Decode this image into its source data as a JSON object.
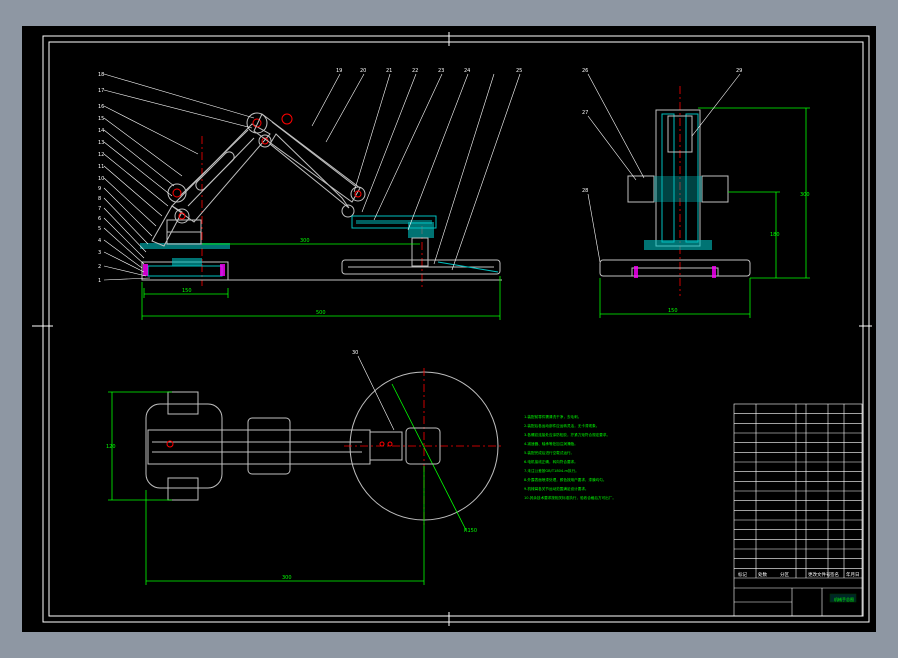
{
  "colors": {
    "background": "#8e97a3",
    "paper": "#000000",
    "frame": "#ffffff",
    "dimension": "#00ff00",
    "part": "#c0c0c0",
    "section": "#00c0c0",
    "centerline": "#ff0000",
    "bolt": "#ff00ff",
    "title_block": "#ffffff"
  },
  "drawing": {
    "front_view": {
      "leaders_left": [
        "1",
        "2",
        "3",
        "4",
        "5",
        "6",
        "7",
        "8",
        "9",
        "10",
        "11",
        "12",
        "13",
        "14",
        "15",
        "16",
        "17",
        "18"
      ],
      "leaders_top": [
        "19",
        "20",
        "21",
        "22",
        "23",
        "24",
        "25"
      ],
      "dim_base": "150",
      "dim_total": "500",
      "dim_height": "300"
    },
    "side_view": {
      "leaders": [
        "26",
        "27",
        "28",
        "29"
      ],
      "dim_width": "150",
      "dim_height_1": "180",
      "dim_height_2": "300"
    },
    "top_view": {
      "leader": "30",
      "dim_height": "120",
      "dim_length": "300",
      "dim_radius": "R150"
    },
    "technical_requirements": [
      "1.装配前零件需清洗干净，去毛刺。",
      "2.装配后各运动部件应运转灵活，无卡滞现象。",
      "3.各螺纹连接处应涂防松胶，拧紧力矩符合规定要求。",
      "4.减速器、轴承等处加注润滑脂。",
      "5.装配完成后进行空载试运行。",
      "6.电机接线正确，转向符合要求。",
      "7.未注公差按GB/T1804-m执行。",
      "8.外露表面喷漆处理，颜色按用户要求，漆膜均匀。",
      "9.机械臂各关节运动范围满足设计要求。",
      "10.其余技术要求按相关标准执行，验收合格后方可出厂。"
    ],
    "title_block": {
      "drawing_name": "机械手总图",
      "header_labels": [
        "标记",
        "处数",
        "分区",
        "更改文件号",
        "签名",
        "年月日"
      ],
      "rows": 18
    }
  }
}
